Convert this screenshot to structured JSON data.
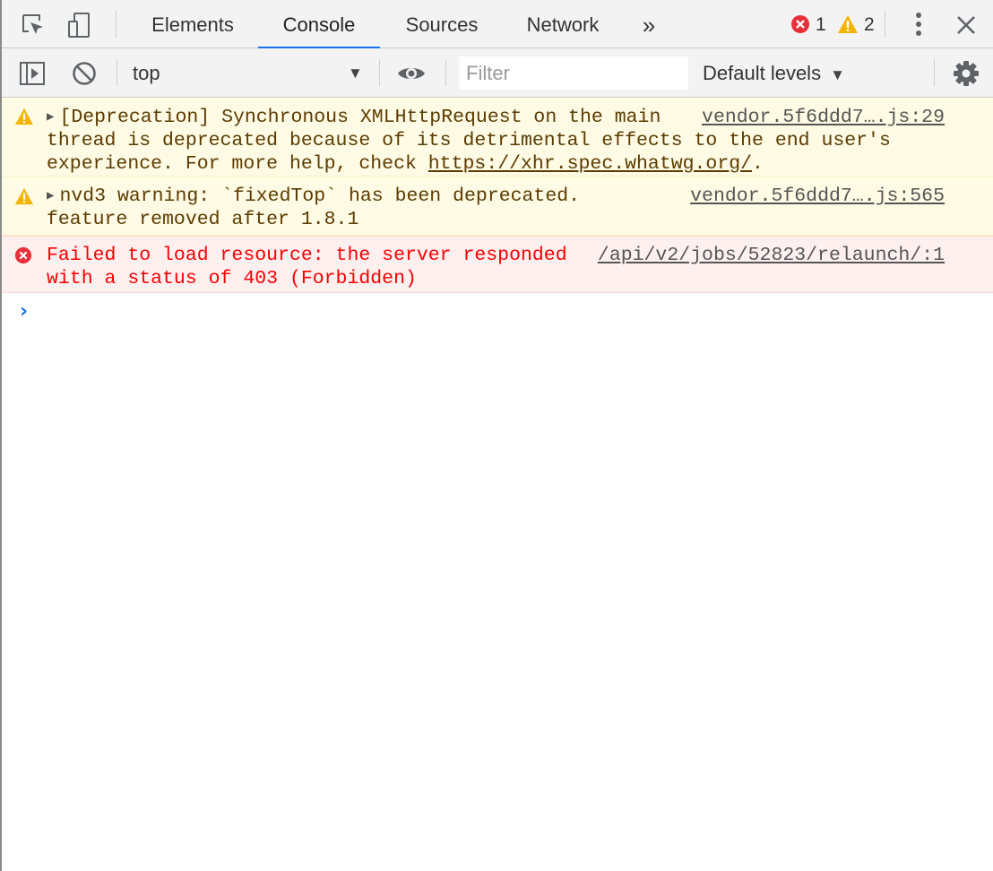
{
  "tabs": [
    {
      "label": "Elements"
    },
    {
      "label": "Console"
    },
    {
      "label": "Sources"
    },
    {
      "label": "Network"
    }
  ],
  "more_tabs_glyph": "»",
  "counts": {
    "errors": "1",
    "warnings": "2"
  },
  "toolbar": {
    "context": "top",
    "filter_placeholder": "Filter",
    "levels_label": "Default levels"
  },
  "messages": [
    {
      "level": "warning",
      "lines": [
        "[Deprecation] Synchronous XMLHttpRequest on the main",
        "thread is deprecated because of its detrimental effects to the end user's",
        "experience. For more help, check "
      ],
      "link": "https://xhr.spec.whatwg.org/",
      "link_suffix": ".",
      "source": "vendor.5f6ddd7….js:29"
    },
    {
      "level": "warning",
      "lines": [
        "nvd3 warning: `fixedTop` has been deprecated.",
        "feature removed after 1.8.1"
      ],
      "source": "vendor.5f6ddd7….js:565"
    },
    {
      "level": "error",
      "lines": [
        "Failed to load resource: the server responded",
        "with a status of 403 (Forbidden)"
      ],
      "source": "/api/v2/jobs/52823/relaunch/:1"
    }
  ],
  "prompt_glyph": "›",
  "colors": {
    "accent": "#1a73e8",
    "error": "#e8303b",
    "warning": "#f4b400",
    "warning_bg": "#fffbe5",
    "error_bg": "#fff0f0"
  }
}
